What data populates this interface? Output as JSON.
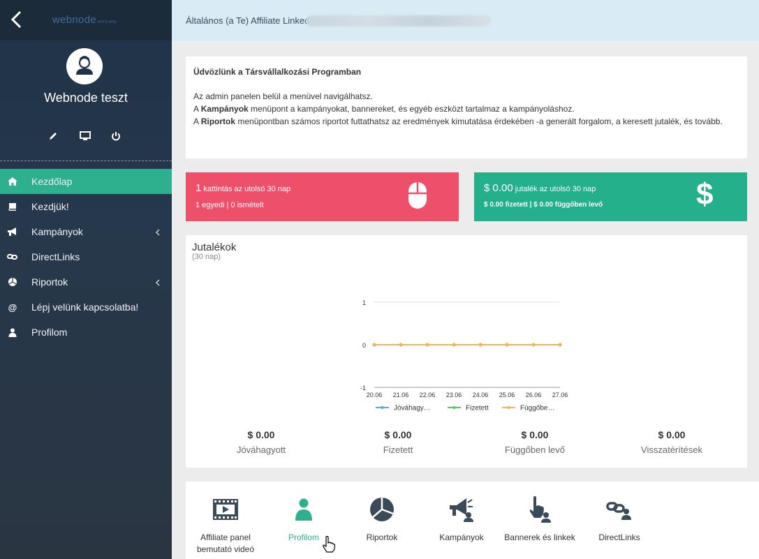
{
  "sidebar": {
    "brand": "webnode",
    "brand_sub": "AFFILIATE",
    "username": "Webnode teszt",
    "tools": [
      {
        "icon": "pencil-icon"
      },
      {
        "icon": "monitor-icon"
      },
      {
        "icon": "power-icon"
      }
    ],
    "nav": [
      {
        "label": "Kezdőlap",
        "icon": "home-icon",
        "active": true
      },
      {
        "label": "Kezdjük!",
        "icon": "book-icon"
      },
      {
        "label": "Kampányok",
        "icon": "megaphone-icon",
        "has_submenu": true
      },
      {
        "label": "DirectLinks",
        "icon": "link-icon"
      },
      {
        "label": "Riportok",
        "icon": "pie-chart-icon",
        "has_submenu": true
      },
      {
        "label": "Lépj velünk kapcsolatba!",
        "icon": "at-icon"
      },
      {
        "label": "Profilom",
        "icon": "user-icon"
      }
    ]
  },
  "header": {
    "breadcrumb": "Általános (a Te) Affiliate Linked"
  },
  "welcome": {
    "title": "Üdvözlünk a Társvállalkozási Programban",
    "line1": "Az admin panelen belül a menüvel navigálhatsz.",
    "line2_pre": "A ",
    "line2_bold": "Kampányok",
    "line2_post": " menüpont a kampányokat, bannereket, és egyéb eszközt tartalmaz a kampányoláshoz.",
    "line3_pre": "A ",
    "line3_bold": "Riportok",
    "line3_post": " menüpontban számos riportot futtathatsz az eredmények kimutatása érdekében -a generált forgalom, a keresett jutalék, és tovább."
  },
  "stats": {
    "clicks": {
      "big": "1",
      "text": " kattintás az utolsó 30 nap",
      "sub": "1 egyedi | 0 ismételt",
      "color": "#ef5069"
    },
    "commission": {
      "big": "$ 0.00",
      "text": " jutalék az utolsó 30 nap",
      "sub": "$ 0.00 fizetett | $ 0.00 függőben levő",
      "color": "#23b08b"
    }
  },
  "chart": {
    "title": "Jutalékok",
    "subtitle": "(30 nap)"
  },
  "chart_data": {
    "type": "line",
    "x": [
      "20.06",
      "21.06",
      "22.06",
      "23.06",
      "24.06",
      "25.06",
      "26.06",
      "27.06"
    ],
    "ylim": [
      -1,
      1
    ],
    "yticks": [
      1,
      0,
      -1
    ],
    "grid": true,
    "legend_position": "bottom",
    "series": [
      {
        "name": "Jóváhagy…",
        "color": "#5aa9d6",
        "values": [
          0,
          0,
          0,
          0,
          0,
          0,
          0,
          0
        ],
        "visible": false
      },
      {
        "name": "Fizetett",
        "color": "#5cc85c",
        "values": [
          0,
          0,
          0,
          0,
          0,
          0,
          0,
          0
        ],
        "visible": false
      },
      {
        "name": "Függőbe…",
        "color": "#f0b45a",
        "values": [
          0,
          0,
          0,
          0,
          0,
          0,
          0,
          0
        ],
        "visible": true
      }
    ]
  },
  "totals": [
    {
      "value": "$ 0.00",
      "label": "Jóváhagyott"
    },
    {
      "value": "$ 0.00",
      "label": "Fizetett"
    },
    {
      "value": "$ 0.00",
      "label": "Függőben levő"
    },
    {
      "value": "$ 0.00",
      "label": "Visszatérítések"
    }
  ],
  "shortcuts": [
    {
      "label": "Affiliate panel bemutató videó",
      "icon": "video-icon"
    },
    {
      "label": "Profilom",
      "icon": "user-icon",
      "selected": true
    },
    {
      "label": "Riportok",
      "icon": "pie-chart-icon"
    },
    {
      "label": "Kampányok",
      "icon": "megaphone-icon"
    },
    {
      "label": "Bannerek és linkek",
      "icon": "banner-hand-icon"
    },
    {
      "label": "DirectLinks",
      "icon": "directlink-icon"
    }
  ],
  "colors": {
    "accent": "#2eaf8e",
    "red": "#ef5069",
    "sidebar": "#26384b"
  }
}
